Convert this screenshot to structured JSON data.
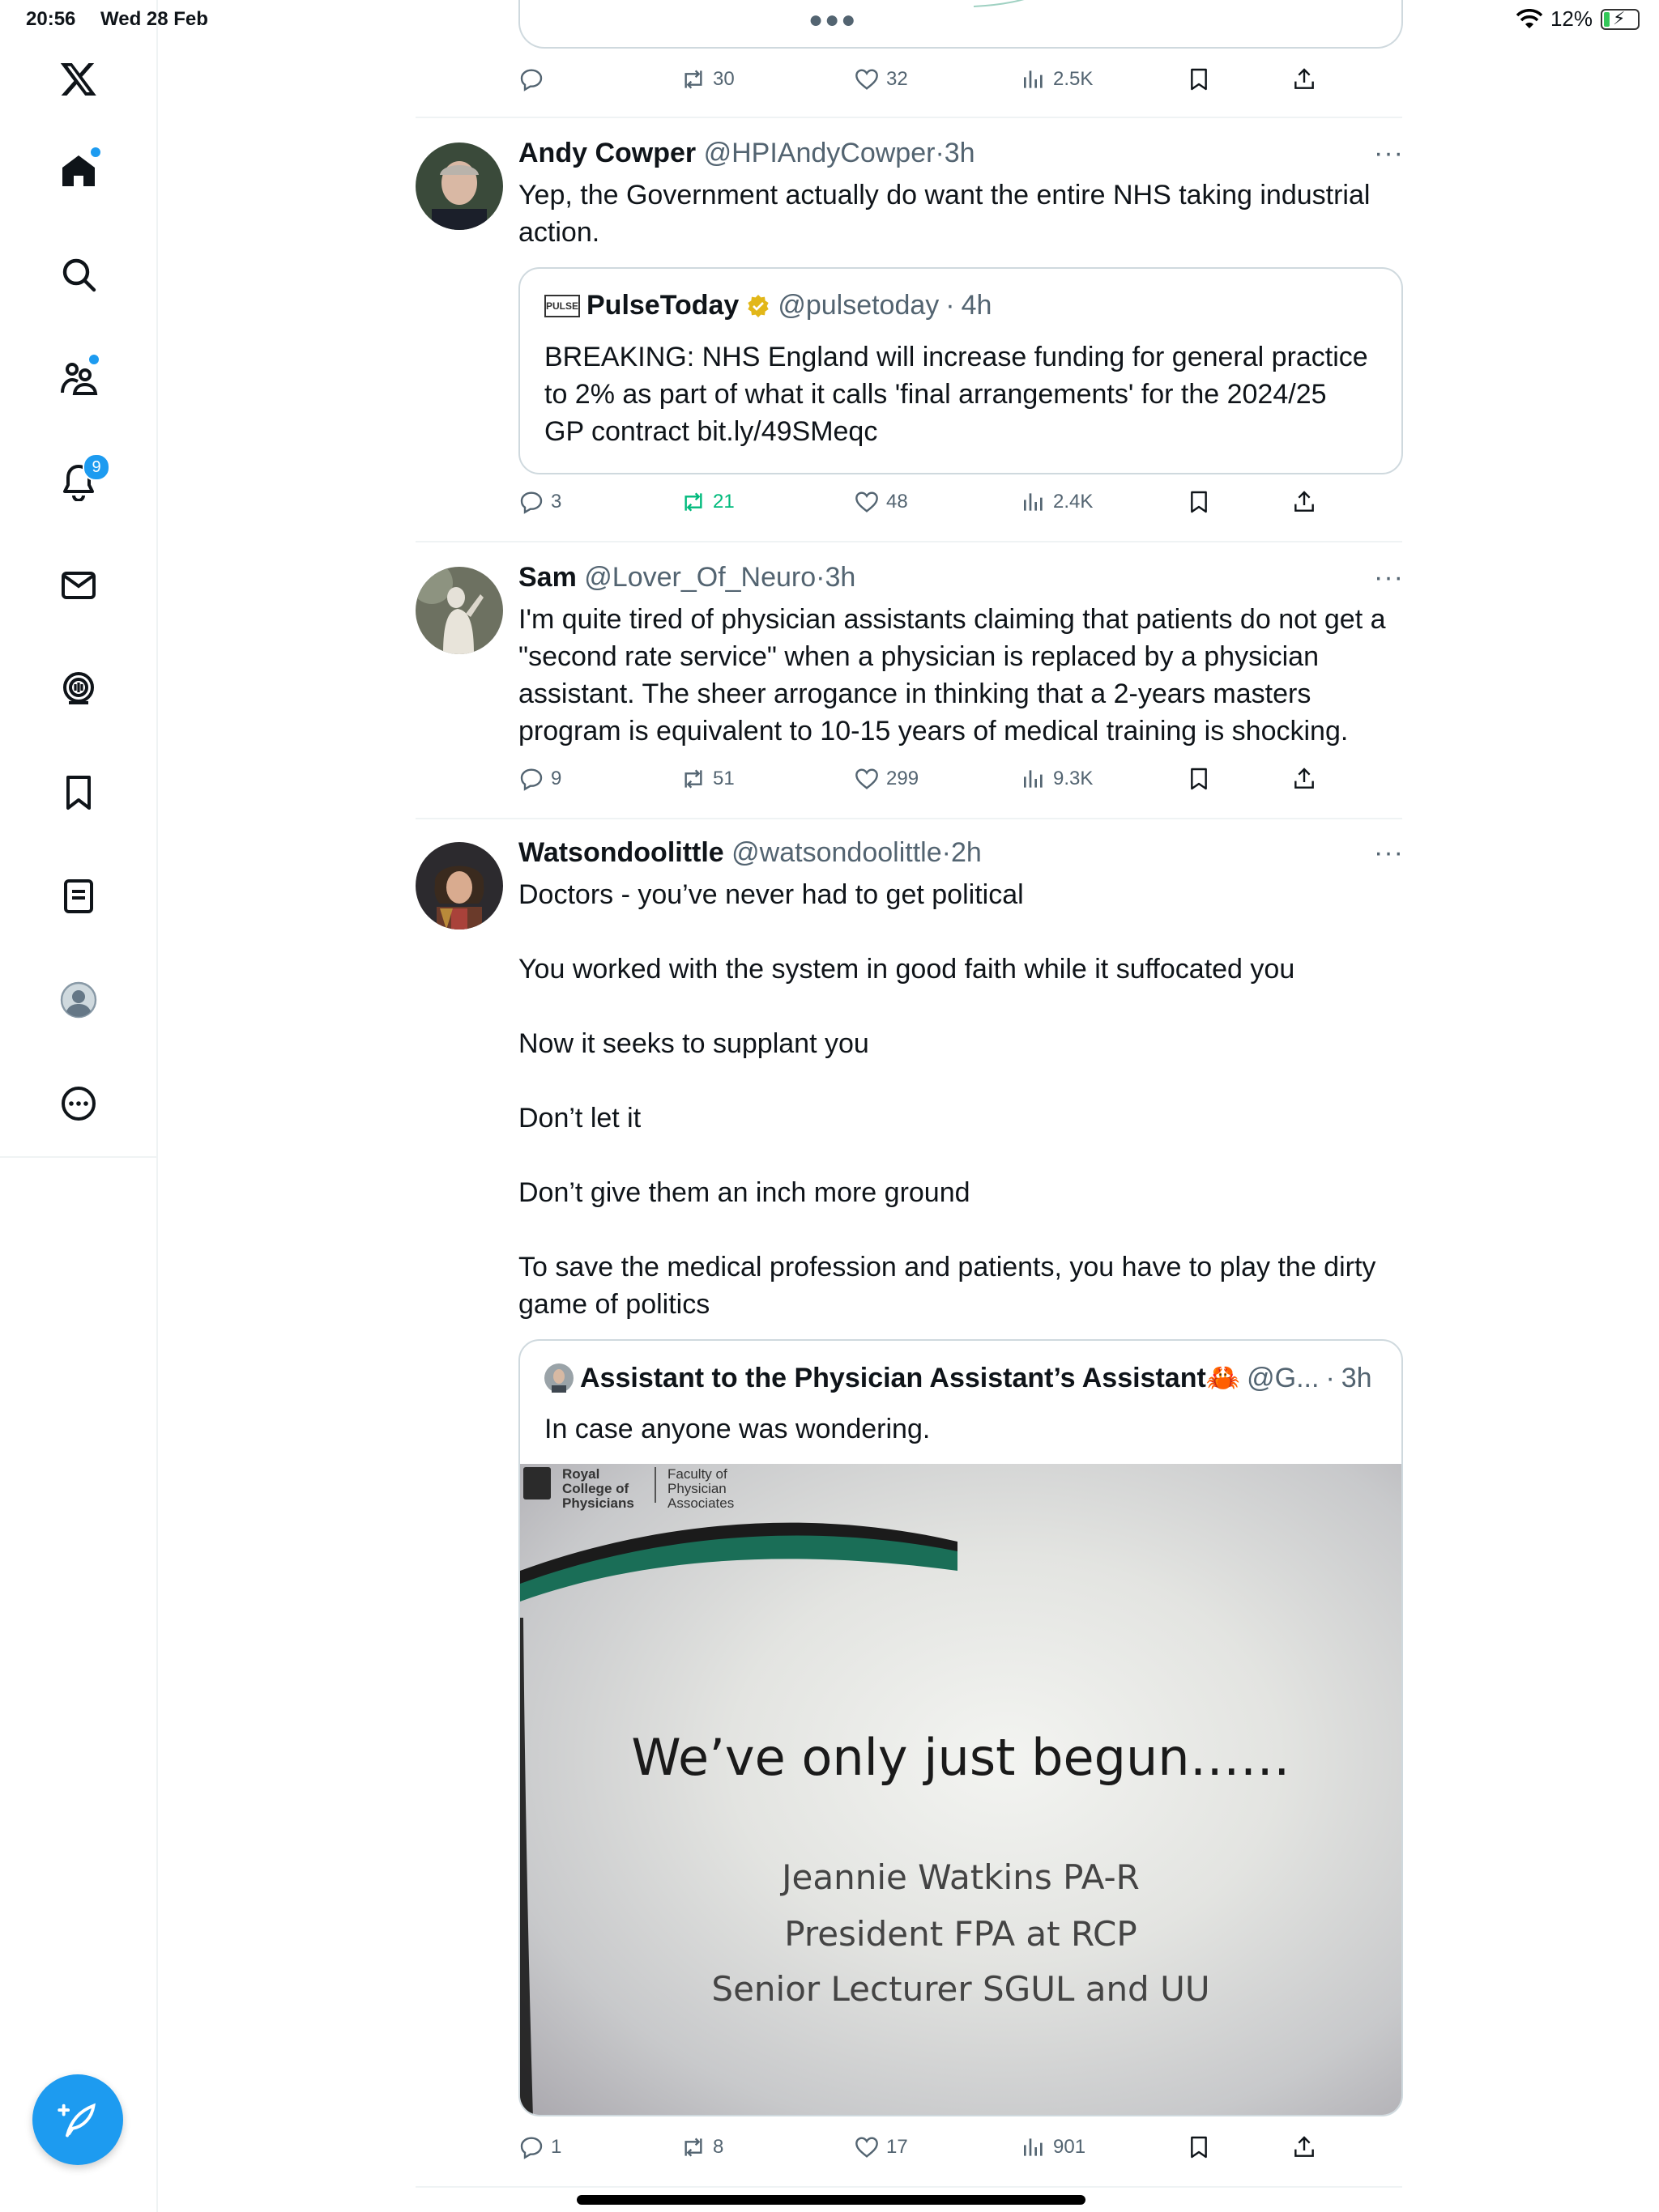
{
  "status_bar": {
    "time": "20:56",
    "date": "Wed 28 Feb",
    "battery": "12%"
  },
  "sidebar": {
    "notifications_count": "9",
    "items": [
      "home-icon",
      "search-icon",
      "communities-icon",
      "notifications-icon",
      "messages-icon",
      "spaces-icon",
      "bookmarks-icon",
      "lists-icon",
      "profile-icon",
      "more-icon"
    ]
  },
  "prev_post": {
    "stats": {
      "replies": "",
      "reposts": "30",
      "likes": "32",
      "views": "2.5K"
    }
  },
  "posts": [
    {
      "name": "Andy Cowper",
      "handle": "@HPIAndyCowper",
      "sep": "·",
      "time": "3h",
      "text": "Yep, the Government actually do want the entire NHS taking industrial action.",
      "quote": {
        "name": "PulseToday",
        "handle": "@pulsetoday",
        "sep": "·",
        "time": "4h",
        "logo": "PULSE",
        "text": "BREAKING: NHS England will increase funding for general practice to 2% as part of what it calls 'final arrangements' for the 2024/25 GP contract bit.ly/49SMeqc"
      },
      "stats": {
        "replies": "3",
        "reposts": "21",
        "likes": "48",
        "views": "2.4K"
      }
    },
    {
      "name": "Sam",
      "handle": "@Lover_Of_Neuro",
      "sep": "·",
      "time": "3h",
      "text": "I'm quite tired of physician assistants claiming that patients do not get a \"second rate service\" when a physician is replaced by a physician assistant. The sheer arrogance in thinking that a 2-years masters program is equivalent to 10-15 years of medical training is shocking.",
      "stats": {
        "replies": "9",
        "reposts": "51",
        "likes": "299",
        "views": "9.3K"
      }
    },
    {
      "name": "Watsondoolittle",
      "handle": "@watsondoolittle",
      "sep": "·",
      "time": "2h",
      "text": "Doctors - you’ve never had to get political\n\nYou worked with the system in good faith while it suffocated you\n\nNow it seeks to supplant you\n\nDon’t let it\n\nDon’t give them an inch more ground\n\nTo save the medical profession and patients, you have to play the dirty game of politics",
      "quote": {
        "name": "Assistant to the Physician Assistant’s Assistant🦀",
        "handle": "@G...",
        "sep": "·",
        "time": "3h",
        "text": "In case anyone was wondering.",
        "image": {
          "logo_college": "Royal College of Physicians",
          "logo_faculty": "Faculty of Physician Associates",
          "headline": "We’ve only just begun……",
          "line1": "Jeannie Watkins PA-R",
          "line2": "President FPA at RCP",
          "line3": "Senior Lecturer SGUL and UU"
        }
      },
      "stats": {
        "replies": "1",
        "reposts": "8",
        "likes": "17",
        "views": "901"
      }
    }
  ],
  "colors": {
    "accent": "#1d9bf0",
    "repost_active": "#00ba7c",
    "muted": "#536471",
    "border": "#cfd9de"
  }
}
